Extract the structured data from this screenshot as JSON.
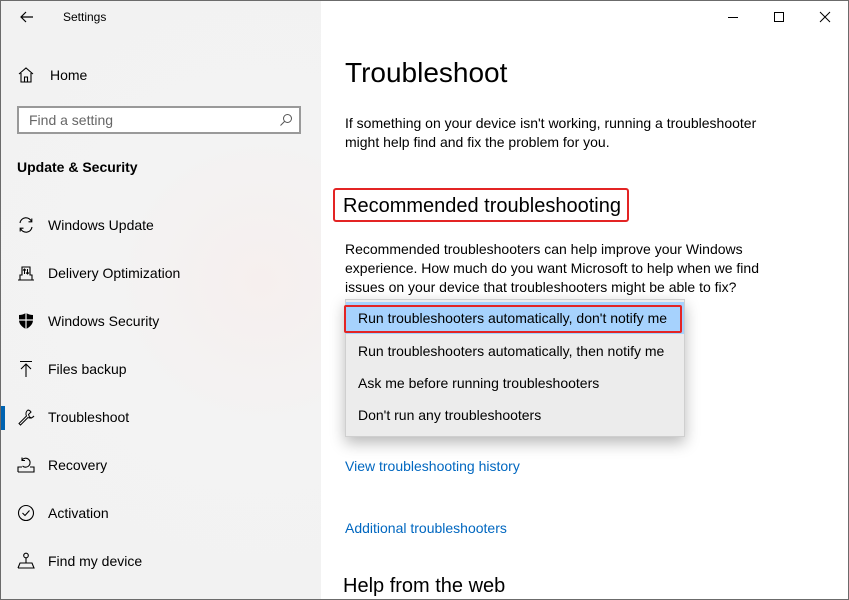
{
  "window": {
    "title": "Settings",
    "controls": {
      "minimize": "minimize",
      "maximize": "maximize",
      "close": "close"
    }
  },
  "sidebar": {
    "home_label": "Home",
    "search": {
      "placeholder": "Find a setting",
      "value": ""
    },
    "section_label": "Update & Security",
    "items": [
      {
        "label": "Windows Update",
        "icon": "sync-icon",
        "active": false
      },
      {
        "label": "Delivery Optimization",
        "icon": "delivery-optimization-icon",
        "active": false
      },
      {
        "label": "Windows Security",
        "icon": "shield-icon",
        "active": false
      },
      {
        "label": "Files backup",
        "icon": "upload-arrow-icon",
        "active": false
      },
      {
        "label": "Troubleshoot",
        "icon": "wrench-icon",
        "active": true
      },
      {
        "label": "Recovery",
        "icon": "recovery-icon",
        "active": false
      },
      {
        "label": "Activation",
        "icon": "check-circle-icon",
        "active": false
      },
      {
        "label": "Find my device",
        "icon": "find-device-icon",
        "active": false
      }
    ],
    "accent_color": "#0063b1"
  },
  "main": {
    "title": "Troubleshoot",
    "intro": "If something on your device isn't working, running a troubleshooter might help find and fix the problem for you.",
    "recommended": {
      "heading": "Recommended troubleshooting",
      "description": "Recommended troubleshooters can help improve your Windows experience. How much do you want Microsoft to help when we find issues on your device that troubleshooters might be able to fix?",
      "dropdown": {
        "selected_index": 0,
        "options": [
          "Run troubleshooters automatically, don't notify me",
          "Run troubleshooters automatically, then notify me",
          "Ask me before running troubleshooters",
          "Don't run any troubleshooters"
        ]
      }
    },
    "links": {
      "history": "View troubleshooting history",
      "additional": "Additional troubleshooters"
    },
    "help_heading": "Help from the web",
    "link_color": "#0067c0",
    "annotation_color": "#e32424"
  }
}
